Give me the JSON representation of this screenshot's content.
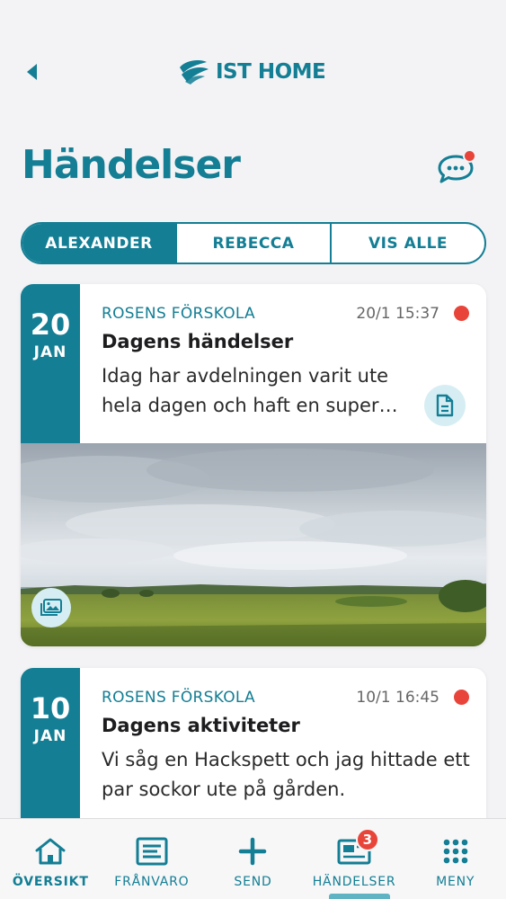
{
  "header": {
    "back_icon": "chevron-left-icon",
    "logo_text": "IST HOME"
  },
  "page": {
    "title": "Händelser",
    "chat_icon": "chat-bubble-icon",
    "chat_has_notification": true
  },
  "filter": {
    "options": [
      "ALEXANDER",
      "REBECCA",
      "VIS ALLE"
    ],
    "selected": "ALEXANDER"
  },
  "events": [
    {
      "day": "20",
      "month": "JAN",
      "school": "ROSENS FÖRSKOLA",
      "time": "20/1 15:37",
      "title": "Dagens händelser",
      "body": "Idag har avdelningen varit ute hela dagen och haft en super…",
      "unread": true,
      "has_document": true,
      "has_photo": true
    },
    {
      "day": "10",
      "month": "JAN",
      "school": "ROSENS FÖRSKOLA",
      "time": "10/1 16:45",
      "title": "Dagens aktiviteter",
      "body": "Vi såg en Hackspett och jag hittade ett par sockor ute på gården.",
      "unread": true
    }
  ],
  "tabbar": {
    "items": [
      {
        "label": "ÖVERSIKT",
        "icon": "home-icon"
      },
      {
        "label": "FRÅNVARO",
        "icon": "form-icon"
      },
      {
        "label": "SEND",
        "icon": "plus-icon"
      },
      {
        "label": "HÄNDELSER",
        "icon": "news-icon",
        "badge": "3"
      },
      {
        "label": "MENY",
        "icon": "grid-icon"
      }
    ],
    "active": "HÄNDELSER"
  },
  "colors": {
    "brand": "#137e94",
    "alert": "#e8443a",
    "icon_bg": "#d6eef3"
  }
}
